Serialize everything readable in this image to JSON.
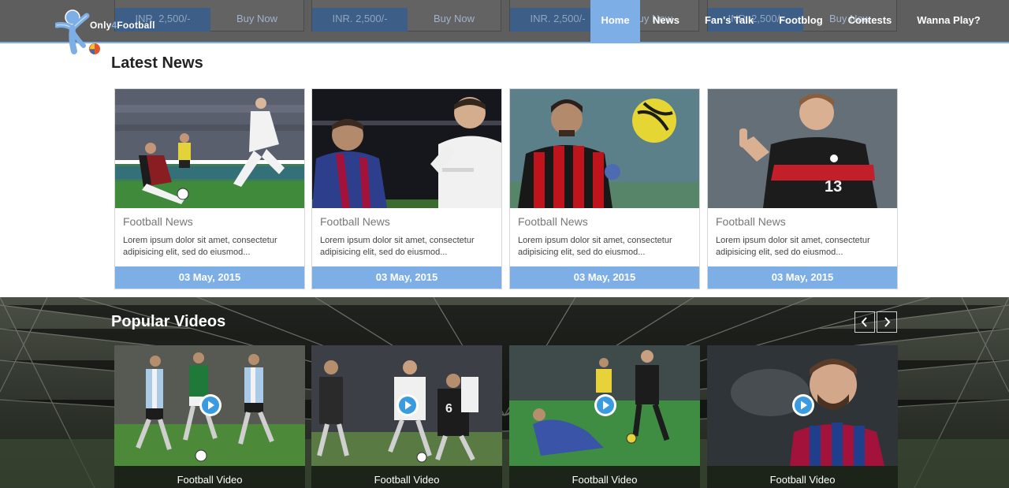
{
  "brand": {
    "name_part1": "Only",
    "name_part2": "4",
    "name_part3": "Football"
  },
  "promos": [
    {
      "price": "INR. 2,500/-",
      "buy": "Buy Now"
    },
    {
      "price": "INR. 2,500/-",
      "buy": "Buy Now"
    },
    {
      "price": "INR. 2,500/-",
      "buy": "Buy Now"
    },
    {
      "price": "INR. 2,500/-",
      "buy": "Buy Now"
    }
  ],
  "nav": [
    {
      "label": "Home",
      "active": true
    },
    {
      "label": "News"
    },
    {
      "label": "Fan's Talk"
    },
    {
      "label": "Footblog"
    },
    {
      "label": "Contests"
    },
    {
      "label": "Wanna Play?"
    }
  ],
  "latest_news": {
    "title": "Latest News",
    "cards": [
      {
        "category": "Football News",
        "excerpt": "Lorem ipsum dolor sit amet, consectetur adipisicing elit, sed do eiusmod...",
        "date": "03 May, 2015"
      },
      {
        "category": "Football News",
        "excerpt": "Lorem ipsum dolor sit amet, consectetur adipisicing elit, sed do eiusmod...",
        "date": "03 May, 2015"
      },
      {
        "category": "Football News",
        "excerpt": "Lorem ipsum dolor sit amet, consectetur adipisicing elit, sed do eiusmod...",
        "date": "03 May, 2015"
      },
      {
        "category": "Football News",
        "excerpt": "Lorem ipsum dolor sit amet, consectetur adipisicing elit, sed do eiusmod...",
        "date": "03 May, 2015"
      }
    ]
  },
  "popular_videos": {
    "title": "Popular Videos",
    "prev_icon": "chevron-left-icon",
    "next_icon": "chevron-right-icon",
    "cards": [
      {
        "caption": "Football Video"
      },
      {
        "caption": "Football Video"
      },
      {
        "caption": "Football Video"
      },
      {
        "caption": "Football Video"
      }
    ]
  },
  "colors": {
    "accent": "#7eaee6",
    "topbar": "#5e5e5e",
    "price_bg": "#3d5e86"
  }
}
